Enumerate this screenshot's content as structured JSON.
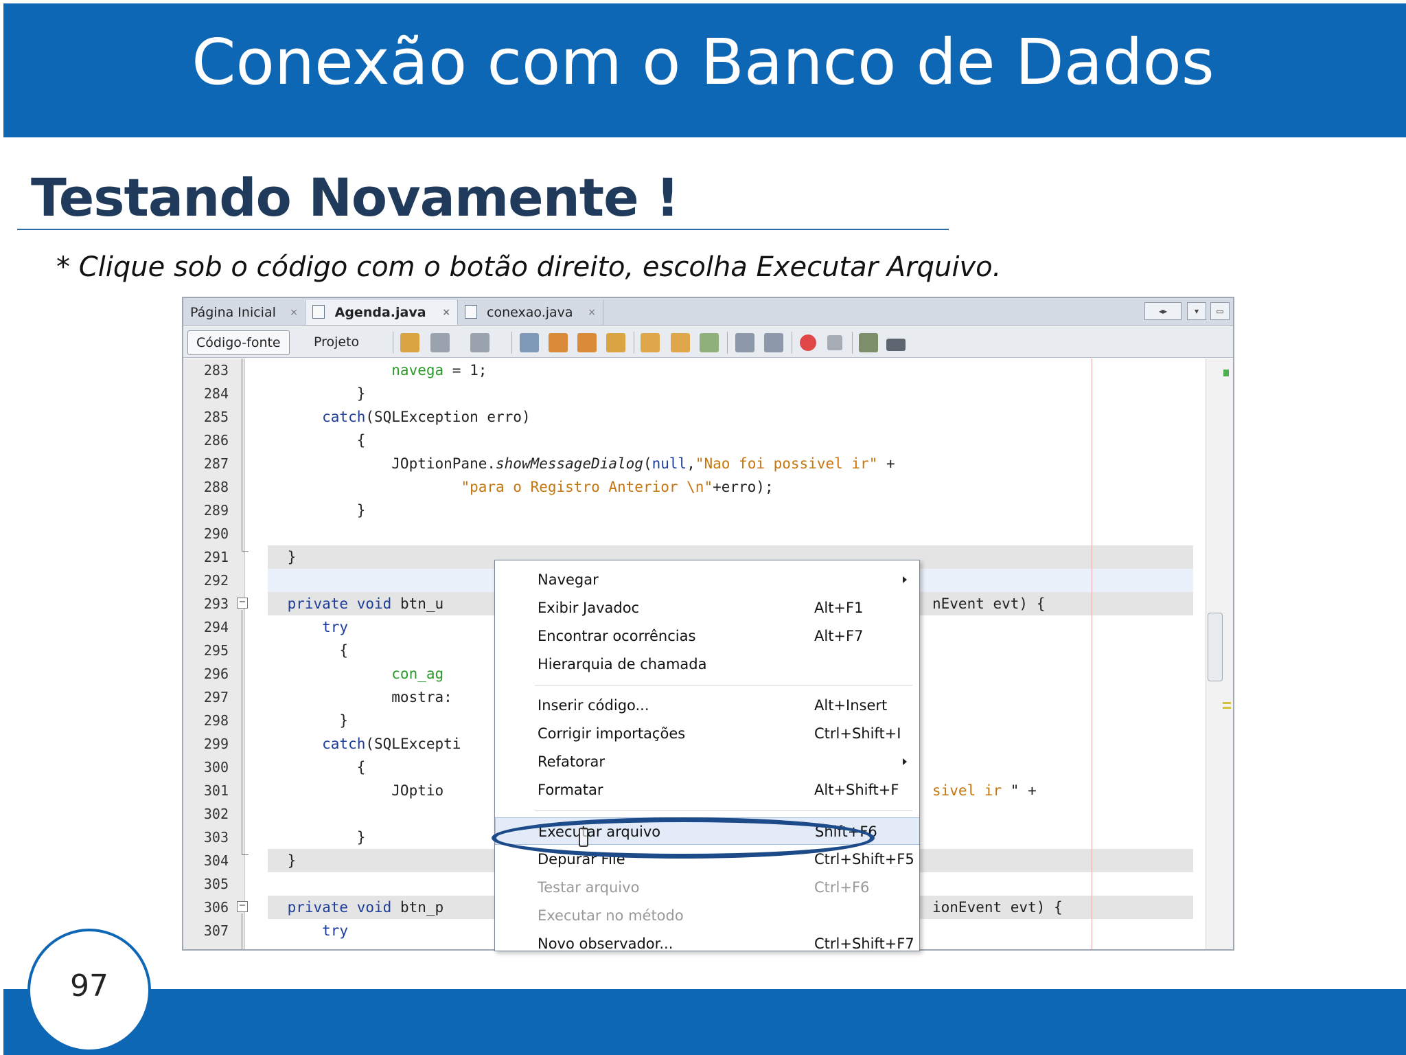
{
  "slide": {
    "title": "Conexão com o Banco de Dados",
    "subtitle": "Testando Novamente !",
    "instruction": "* Clique sob o código com o botão direito, escolha Executar Arquivo.",
    "page_number": "97",
    "colors": {
      "header": "#0e67b5",
      "subtitle": "#1f3a5a"
    }
  },
  "ide": {
    "tabs": [
      {
        "label": "Página Inicial",
        "close": "×",
        "active": false
      },
      {
        "label": "Agenda.java",
        "close": "×",
        "active": true
      },
      {
        "label": "conexao.java",
        "close": "×",
        "active": false
      }
    ],
    "window_controls": [
      "◂▸",
      "▾",
      "▭"
    ],
    "modes": {
      "source": "Código-fonte",
      "design": "Projeto"
    },
    "toolbar_icons": [
      "back-icon",
      "forward-icon",
      "find-selection-icon",
      "previous-occurrence-icon",
      "next-occurrence-icon",
      "toggle-highlight-icon",
      "previous-bookmark-icon",
      "next-bookmark-icon",
      "toggle-bookmark-icon",
      "shift-left-icon",
      "shift-right-icon",
      "start-macro-icon",
      "stop-macro-icon",
      "comment-icon",
      "uncomment-icon"
    ],
    "code_lines": [
      {
        "num": "283",
        "parts": [
          {
            "t": "                navega",
            "c": "grn"
          },
          {
            "t": " = 1;",
            "c": ""
          }
        ]
      },
      {
        "num": "284",
        "parts": [
          {
            "t": "            }",
            "c": ""
          }
        ]
      },
      {
        "num": "285",
        "parts": [
          {
            "t": "        catch",
            "c": "kw"
          },
          {
            "t": "(SQLException erro)",
            "c": ""
          }
        ]
      },
      {
        "num": "286",
        "parts": [
          {
            "t": "            {",
            "c": ""
          }
        ]
      },
      {
        "num": "287",
        "parts": [
          {
            "t": "                JOptionPane.",
            "c": ""
          },
          {
            "t": "showMessageDialog",
            "c": "it"
          },
          {
            "t": "(",
            "c": ""
          },
          {
            "t": "null",
            "c": "kw"
          },
          {
            "t": ",",
            "c": ""
          },
          {
            "t": "\"Nao foi possivel ir\"",
            "c": "str"
          },
          {
            "t": " +",
            "c": ""
          }
        ]
      },
      {
        "num": "288",
        "parts": [
          {
            "t": "                        ",
            "c": ""
          },
          {
            "t": "\"para o Registro Anterior \\n\"",
            "c": "str"
          },
          {
            "t": "+erro);",
            "c": ""
          }
        ]
      },
      {
        "num": "289",
        "parts": [
          {
            "t": "            }",
            "c": ""
          }
        ]
      },
      {
        "num": "290",
        "parts": [
          {
            "t": "",
            "c": ""
          }
        ]
      },
      {
        "num": "291",
        "parts": [
          {
            "t": "    }",
            "c": ""
          }
        ]
      },
      {
        "num": "292",
        "parts": [
          {
            "t": "",
            "c": ""
          }
        ]
      },
      {
        "num": "293",
        "parts": [
          {
            "t": "    private void",
            "c": "kw"
          },
          {
            "t": " btn_u",
            "c": ""
          }
        ]
      },
      {
        "num": "294",
        "parts": [
          {
            "t": "        try",
            "c": "kw"
          }
        ]
      },
      {
        "num": "295",
        "parts": [
          {
            "t": "          {",
            "c": ""
          }
        ]
      },
      {
        "num": "296",
        "parts": [
          {
            "t": "                con_ag",
            "c": "grn"
          }
        ]
      },
      {
        "num": "297",
        "parts": [
          {
            "t": "                mostra:",
            "c": ""
          }
        ]
      },
      {
        "num": "298",
        "parts": [
          {
            "t": "          }",
            "c": ""
          }
        ]
      },
      {
        "num": "299",
        "parts": [
          {
            "t": "        catch",
            "c": "kw"
          },
          {
            "t": "(SQLExcepti",
            "c": ""
          }
        ]
      },
      {
        "num": "300",
        "parts": [
          {
            "t": "            {",
            "c": ""
          }
        ]
      },
      {
        "num": "301",
        "parts": [
          {
            "t": "                JOptio",
            "c": ""
          }
        ]
      },
      {
        "num": "302",
        "parts": [
          {
            "t": "",
            "c": ""
          }
        ]
      },
      {
        "num": "303",
        "parts": [
          {
            "t": "            }",
            "c": ""
          }
        ]
      },
      {
        "num": "304",
        "parts": [
          {
            "t": "    }",
            "c": ""
          }
        ]
      },
      {
        "num": "305",
        "parts": [
          {
            "t": "",
            "c": ""
          }
        ]
      },
      {
        "num": "306",
        "parts": [
          {
            "t": "    private void",
            "c": "kw"
          },
          {
            "t": " btn_p",
            "c": ""
          }
        ]
      },
      {
        "num": "307",
        "parts": [
          {
            "t": "        try",
            "c": "kw"
          }
        ]
      }
    ],
    "code_fragments_right": {
      "line_293": "nEvent evt) {",
      "line_301_a": "sivel ir ",
      "line_301_b": "\" +",
      "line_306": "ionEvent evt) {"
    }
  },
  "context_menu": {
    "items": [
      {
        "label": "Navegar",
        "shortcut": "",
        "submenu": true,
        "disabled": false
      },
      {
        "label": "Exibir Javadoc",
        "shortcut": "Alt+F1",
        "submenu": false,
        "disabled": false
      },
      {
        "label": "Encontrar ocorrências",
        "shortcut": "Alt+F7",
        "submenu": false,
        "disabled": false
      },
      {
        "label": "Hierarquia de chamada",
        "shortcut": "",
        "submenu": false,
        "disabled": false
      },
      {
        "label": "Inserir código...",
        "shortcut": "Alt+Insert",
        "submenu": false,
        "disabled": false
      },
      {
        "label": "Corrigir importações",
        "shortcut": "Ctrl+Shift+I",
        "submenu": false,
        "disabled": false
      },
      {
        "label": "Refatorar",
        "shortcut": "",
        "submenu": true,
        "disabled": false
      },
      {
        "label": "Formatar",
        "shortcut": "Alt+Shift+F",
        "submenu": false,
        "disabled": false
      },
      {
        "label": "Executar arquivo",
        "shortcut": "Shift+F6",
        "submenu": false,
        "disabled": false,
        "selected": true
      },
      {
        "label": "Depurar File",
        "shortcut": "Ctrl+Shift+F5",
        "submenu": false,
        "disabled": false
      },
      {
        "label": "Testar arquivo",
        "shortcut": "Ctrl+F6",
        "submenu": false,
        "disabled": true
      },
      {
        "label": "Executar no método",
        "shortcut": "",
        "submenu": false,
        "disabled": true
      },
      {
        "label": "Novo observador...",
        "shortcut": "Ctrl+Shift+F7",
        "submenu": false,
        "disabled": false
      }
    ]
  }
}
